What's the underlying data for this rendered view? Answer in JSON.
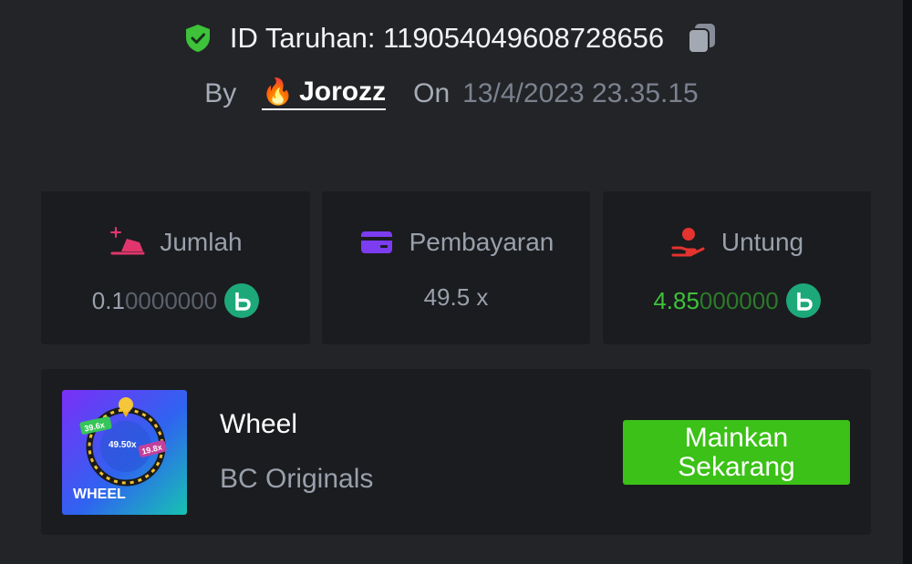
{
  "header": {
    "bet_id_label": "ID Taruhan: 119054049608728656",
    "by_label": "By",
    "username": "Jorozz",
    "on_label": "On",
    "date": "13/4/2023 23.35.15"
  },
  "icons": {
    "verified": "shield-check-icon",
    "copy": "copy-icon",
    "user_badge": "fire-icon",
    "currency": "bc-coin-icon"
  },
  "stats": {
    "amount": {
      "label": "Jumlah",
      "value_main": "0.1",
      "value_dim": "0000000"
    },
    "payout": {
      "label": "Pembayaran",
      "value": "49.5 x"
    },
    "profit": {
      "label": "Untung",
      "value_main": "4.85",
      "value_dim": "000000"
    }
  },
  "game": {
    "name": "Wheel",
    "provider": "BC Originals",
    "thumbnail_title": "WHEEL",
    "thumbnail_labels": [
      "39.6x",
      "49.50x",
      "19.8x"
    ],
    "play_button": "Mainkan\nSekarang"
  },
  "colors": {
    "background": "#232427",
    "card": "#1b1c1f",
    "accent_green": "#3bc117",
    "profit_green": "#3dc23a",
    "shield_green": "#3dc23a"
  }
}
